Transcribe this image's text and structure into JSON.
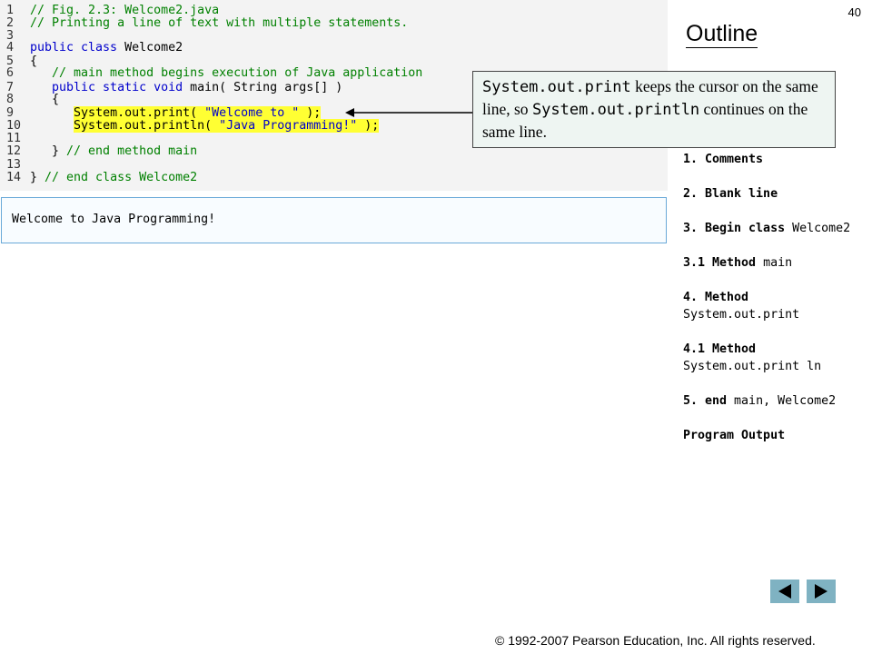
{
  "slide_number": "40",
  "outline_title": "Outline",
  "code_lines": [
    {
      "num": "1",
      "parts": [
        {
          "cls": "comment",
          "text": "// Fig. 2.3: Welcome2.java"
        }
      ]
    },
    {
      "num": "2",
      "parts": [
        {
          "cls": "comment",
          "text": "// Printing a line of text with multiple statements."
        }
      ]
    },
    {
      "num": "3",
      "parts": []
    },
    {
      "num": "4",
      "parts": [
        {
          "cls": "kw",
          "text": "public class "
        },
        {
          "cls": "plain",
          "text": "Welcome2"
        }
      ]
    },
    {
      "num": "5",
      "parts": [
        {
          "cls": "plain",
          "text": "{"
        }
      ]
    },
    {
      "num": "6",
      "parts": [
        {
          "cls": "comment",
          "text": "   // main method begins execution of Java application"
        }
      ]
    },
    {
      "num": "7",
      "parts": [
        {
          "cls": "kw",
          "text": "   public static void "
        },
        {
          "cls": "plain",
          "text": "main( String args[] )"
        }
      ]
    },
    {
      "num": "8",
      "parts": [
        {
          "cls": "plain",
          "text": "   {"
        }
      ]
    },
    {
      "num": "9",
      "parts": [
        {
          "cls": "plain",
          "text": "      "
        },
        {
          "cls": "plain hl",
          "text": "System.out.print( "
        },
        {
          "cls": "str hl",
          "text": "\"Welcome to \""
        },
        {
          "cls": "plain hl",
          "text": " );"
        }
      ]
    },
    {
      "num": "10",
      "parts": [
        {
          "cls": "plain",
          "text": "      "
        },
        {
          "cls": "plain hl",
          "text": "System.out.println( "
        },
        {
          "cls": "str hl",
          "text": "\"Java Programming!\""
        },
        {
          "cls": "plain hl",
          "text": " );"
        }
      ]
    },
    {
      "num": "11",
      "parts": []
    },
    {
      "num": "12",
      "parts": [
        {
          "cls": "plain",
          "text": "   } "
        },
        {
          "cls": "comment",
          "text": "// end method main"
        }
      ]
    },
    {
      "num": "13",
      "parts": []
    },
    {
      "num": "14",
      "parts": [
        {
          "cls": "plain",
          "text": "} "
        },
        {
          "cls": "comment",
          "text": "// end class Welcome2"
        }
      ]
    }
  ],
  "program_output": "Welcome to Java Programming!",
  "callout": {
    "code1": "System.out.print",
    "text1": " keeps the cursor on the same  line, so ",
    "code2": "System.out.println",
    "text2": " continues on the same  line."
  },
  "outline_items": [
    {
      "bold": "1. Comments",
      "rest": ""
    },
    {
      "bold": "2. Blank line",
      "rest": ""
    },
    {
      "bold": "3. Begin class ",
      "rest": "Welcome2"
    },
    {
      "bold": "3.1 Method ",
      "rest": " main"
    },
    {
      "bold": "4. Method ",
      "rest": "System.out.print"
    },
    {
      "bold": "4.1 Method ",
      "rest": "System.out.print ln"
    },
    {
      "bold": "5. end ",
      "rest": "main, Welcome2"
    },
    {
      "bold": "Program Output",
      "rest": ""
    }
  ],
  "nav": {
    "prev_icon": "triangle-left-icon",
    "next_icon": "triangle-right-icon"
  },
  "copyright": "© 1992-2007 Pearson Education, Inc.  All rights reserved."
}
